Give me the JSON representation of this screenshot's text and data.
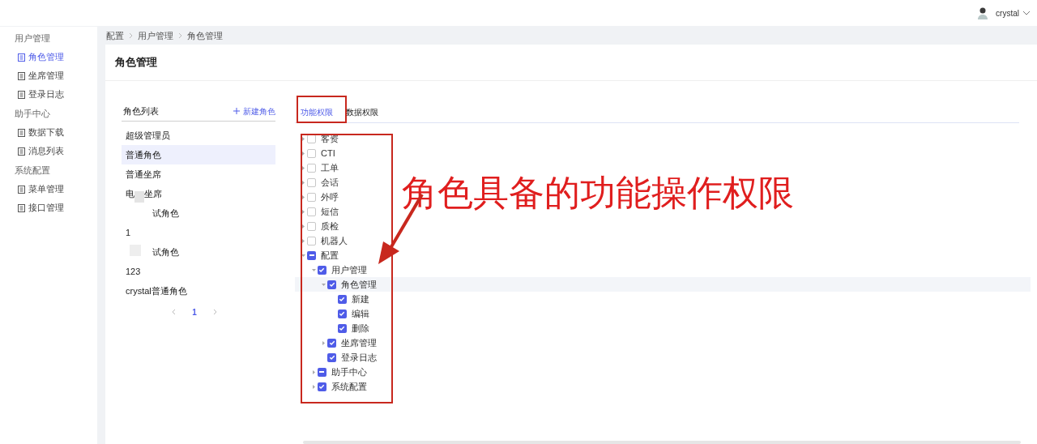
{
  "user": {
    "name": "crystal"
  },
  "sidebar": {
    "groups": [
      {
        "label": "用户管理",
        "items": [
          {
            "label": "角色管理",
            "selected": true
          },
          {
            "label": "坐席管理",
            "selected": false
          },
          {
            "label": "登录日志",
            "selected": false
          }
        ]
      },
      {
        "label": "助手中心",
        "items": [
          {
            "label": "数据下载",
            "selected": false
          },
          {
            "label": "消息列表",
            "selected": false
          }
        ]
      },
      {
        "label": "系统配置",
        "items": [
          {
            "label": "菜单管理",
            "selected": false
          },
          {
            "label": "接口管理",
            "selected": false
          }
        ]
      }
    ]
  },
  "breadcrumb": [
    "配置",
    "用户管理",
    "角色管理"
  ],
  "page_title": "角色管理",
  "role_list": {
    "title": "角色列表",
    "add_button": "新建角色",
    "roles": [
      {
        "kind": "plain",
        "text": "超级管理员",
        "selected": false
      },
      {
        "kind": "plain",
        "text": "普通角色",
        "selected": true
      },
      {
        "kind": "plain",
        "text": "普通坐席",
        "selected": false
      },
      {
        "kind": "split",
        "prefix": "电",
        "text": "坐席",
        "selected": false
      },
      {
        "kind": "covered",
        "text": "试角色",
        "selected": false
      },
      {
        "kind": "plain",
        "text": "1",
        "selected": false
      },
      {
        "kind": "masked",
        "text": "试角色",
        "selected": false
      },
      {
        "kind": "plain",
        "text": "123",
        "selected": false
      },
      {
        "kind": "plain",
        "text": "crystal普通角色",
        "selected": false
      }
    ],
    "pagination": {
      "page": "1"
    }
  },
  "tabs": [
    {
      "label": "功能权限",
      "selected": true
    },
    {
      "label": "数据权限",
      "selected": false
    }
  ],
  "tree": [
    {
      "label": "客资",
      "checked": false,
      "expanded": false
    },
    {
      "label": "CTI",
      "checked": false,
      "expanded": false
    },
    {
      "label": "工单",
      "checked": false,
      "expanded": false
    },
    {
      "label": "会话",
      "checked": false,
      "expanded": false
    },
    {
      "label": "外呼",
      "checked": false,
      "expanded": false
    },
    {
      "label": "短信",
      "checked": false,
      "expanded": false
    },
    {
      "label": "质检",
      "checked": false,
      "expanded": false
    },
    {
      "label": "机器人",
      "checked": false,
      "expanded": false
    },
    {
      "label": "配置",
      "indeterminate": true,
      "expanded": true,
      "children": [
        {
          "label": "用户管理",
          "checked": true,
          "expanded": true,
          "children": [
            {
              "label": "角色管理",
              "checked": true,
              "expanded": true,
              "selected": true,
              "children": [
                {
                  "label": "新建",
                  "checked": true
                },
                {
                  "label": "编辑",
                  "checked": true
                },
                {
                  "label": "删除",
                  "checked": true
                }
              ]
            },
            {
              "label": "坐席管理",
              "checked": true,
              "expanded": false
            },
            {
              "label": "登录日志",
              "checked": true
            }
          ]
        },
        {
          "label": "助手中心",
          "indeterminate": true,
          "expanded": false
        },
        {
          "label": "系统配置",
          "checked": true,
          "expanded": false
        }
      ]
    }
  ],
  "annotation": {
    "text": "角色具备的功能操作权限"
  }
}
